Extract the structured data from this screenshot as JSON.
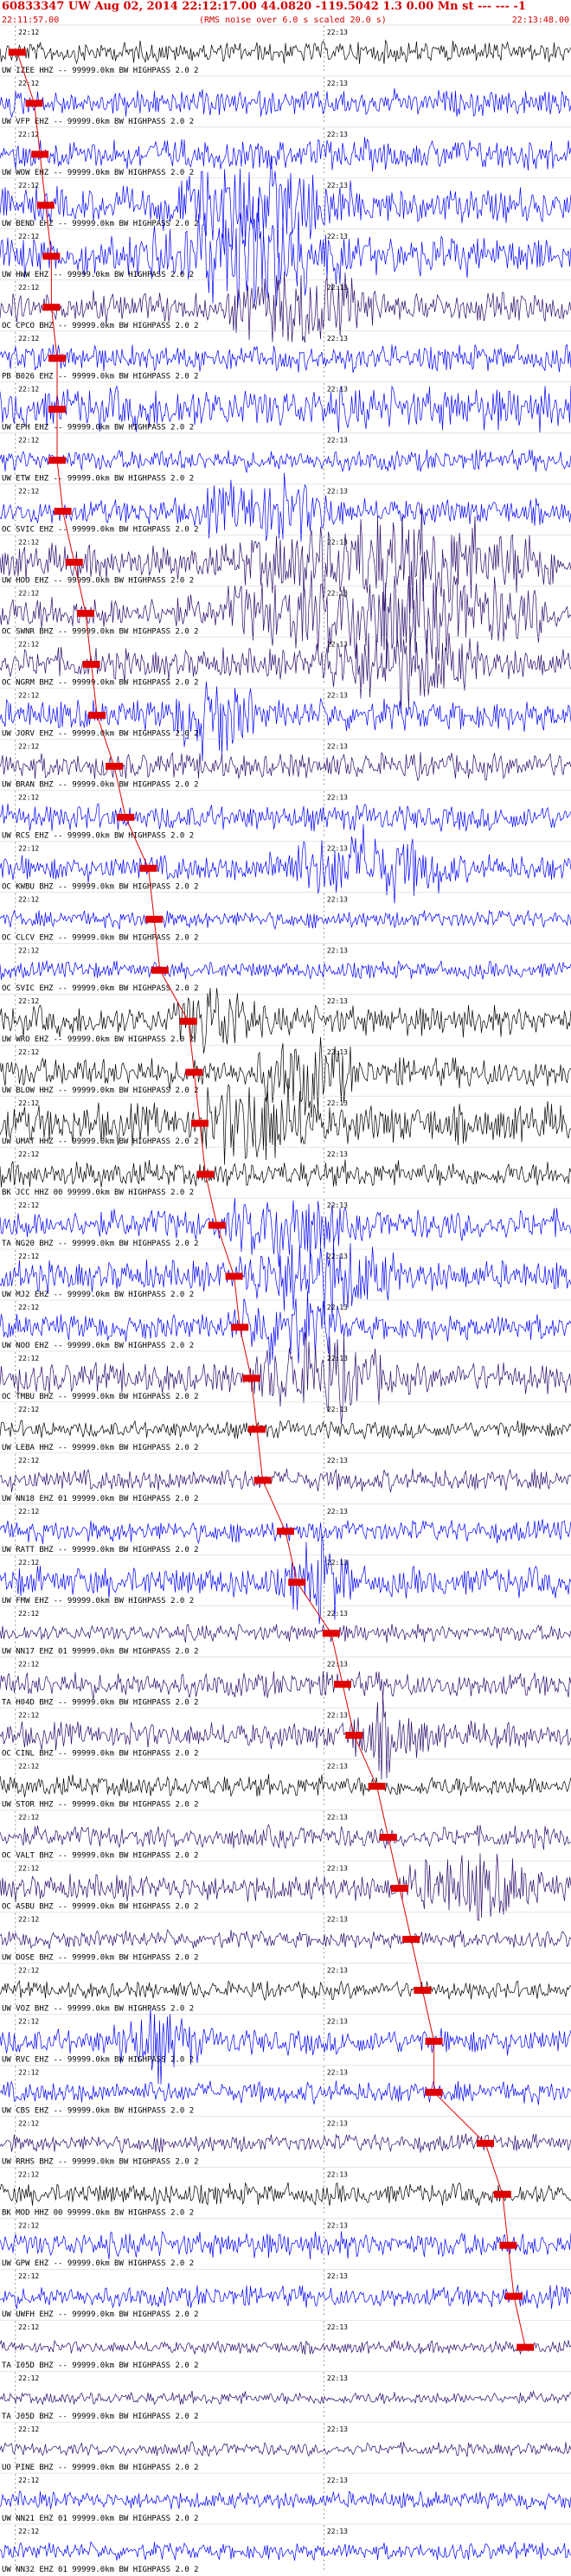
{
  "header": {
    "title": "60833347 UW Aug 02, 2014 22:12:17.00   44.0820  -119.5042  1.3 0.00 Mn st --- --- -1",
    "start_time": "22:11:57.00",
    "noise_note": "(RMS noise over 6.0 s scaled 20.0 s)",
    "end_time": "22:13:48.00"
  },
  "chart_data": {
    "type": "line",
    "time_range": [
      "22:11:57.00",
      "22:13:48.00"
    ],
    "minute_tick_labels": [
      "22:12",
      "22:13"
    ],
    "trace_colors": {
      "black": "#000000",
      "blue": "#0000ff",
      "purple": "#2a0a6a",
      "pick": "#e00000"
    },
    "traces": [
      {
        "label": "UW IZEE HHZ -- 99999.0km BW  HIGHPASS  2.0  2",
        "color": "black",
        "amp": 0.25,
        "burst": null,
        "pick": 0.03
      },
      {
        "label": "UW VFP EHZ -- 99999.0km BW  HIGHPASS  2.0  2",
        "color": "blue",
        "amp": 0.3,
        "burst": null,
        "pick": 0.06
      },
      {
        "label": "UW WOW EHZ -- 99999.0km BW  HIGHPASS  2.0  2",
        "color": "blue",
        "amp": 0.35,
        "burst": null,
        "pick": 0.07
      },
      {
        "label": "UW BEND EHZ -- 99999.0km BW  HIGHPASS  2.0  2",
        "color": "blue",
        "amp": 0.4,
        "burst": [
          0.28,
          0.62
        ],
        "pick": 0.08
      },
      {
        "label": "UW HWW EHZ -- 99999.0km BW  HIGHPASS  2.0  2",
        "color": "blue",
        "amp": 0.45,
        "burst": [
          0.25,
          0.6
        ],
        "pick": 0.09
      },
      {
        "label": "OC CPCO BHZ -- 99999.0km BW  HIGHPASS  2.0  2",
        "color": "purple",
        "amp": 0.35,
        "burst": [
          0.4,
          0.66
        ],
        "pick": 0.09
      },
      {
        "label": "PB B026 EHZ -- 99999.0km BW  HIGHPASS  2.0  2",
        "color": "blue",
        "amp": 0.3,
        "burst": null,
        "pick": 0.1
      },
      {
        "label": "UW EPH EHZ -- 99999.0km BW  HIGHPASS  2.0  2",
        "color": "blue",
        "amp": 0.5,
        "burst": null,
        "pick": 0.1
      },
      {
        "label": "UW ETW EHZ -- 99999.0km BW  HIGHPASS  2.0  2",
        "color": "blue",
        "amp": 0.25,
        "burst": null,
        "pick": 0.1
      },
      {
        "label": "OC SVIC EHZ -- 99999.0km BW  HIGHPASS  2.0  2",
        "color": "blue",
        "amp": 0.3,
        "burst": [
          0.35,
          0.6
        ],
        "pick": 0.11
      },
      {
        "label": "UW HOO EHZ -- 99999.0km BW  HIGHPASS  2.0  2",
        "color": "purple",
        "amp": 0.4,
        "burst": [
          0.42,
          0.98
        ],
        "pick": 0.13
      },
      {
        "label": "OC SWNR BHZ -- 99999.0km BW  HIGHPASS  2.0  2",
        "color": "purple",
        "amp": 0.4,
        "burst": [
          0.4,
          0.95
        ],
        "pick": 0.15
      },
      {
        "label": "OC NGRM BHZ -- 99999.0km BW  HIGHPASS  2.0  2",
        "color": "purple",
        "amp": 0.35,
        "burst": [
          0.55,
          0.85
        ],
        "pick": 0.16
      },
      {
        "label": "UW JORV EHZ -- 99999.0km BW  HIGHPASS  2.0  2",
        "color": "blue",
        "amp": 0.35,
        "burst": [
          0.3,
          0.45
        ],
        "pick": 0.17
      },
      {
        "label": "UW BRAN BHZ -- 99999.0km BW  HIGHPASS  2.0  2",
        "color": "purple",
        "amp": 0.3,
        "burst": null,
        "pick": 0.2
      },
      {
        "label": "UW RCS EHZ -- 99999.0km BW  HIGHPASS  2.0  2",
        "color": "blue",
        "amp": 0.3,
        "burst": null,
        "pick": 0.22
      },
      {
        "label": "OC KWBU BHZ -- 99999.0km BW  HIGHPASS  2.0  2",
        "color": "blue",
        "amp": 0.3,
        "burst": [
          0.47,
          0.8
        ],
        "pick": 0.26
      },
      {
        "label": "OC CLCV EHZ -- 99999.0km BW  HIGHPASS  2.0  2",
        "color": "blue",
        "amp": 0.2,
        "burst": null,
        "pick": 0.27
      },
      {
        "label": "OC SVIC EHZ -- 99999.0km BW  HIGHPASS  2.0  2",
        "color": "blue",
        "amp": 0.2,
        "burst": null,
        "pick": 0.28
      },
      {
        "label": "UW WRO EHZ -- 99999.0km BW  HIGHPASS  2.0  2",
        "color": "black",
        "amp": 0.35,
        "burst": [
          0.3,
          0.45
        ],
        "pick": 0.33
      },
      {
        "label": "UW BLOW HHZ -- 99999.0km BW  HIGHPASS  2.0  2",
        "color": "black",
        "amp": 0.35,
        "burst": [
          0.45,
          0.62
        ],
        "pick": 0.34
      },
      {
        "label": "UW UMAT HHZ -- 99999.0km BW  HIGHPASS  2.0  2",
        "color": "black",
        "amp": 0.45,
        "burst": [
          0.35,
          0.55
        ],
        "pick": 0.35
      },
      {
        "label": "BK JCC HHZ 00 99999.0km BW  HIGHPASS  2.0  2",
        "color": "black",
        "amp": 0.3,
        "burst": null,
        "pick": 0.36
      },
      {
        "label": "TA NG20 BHZ -- 99999.0km BW  HIGHPASS  2.0  2",
        "color": "blue",
        "amp": 0.35,
        "burst": [
          0.4,
          0.6
        ],
        "pick": 0.38
      },
      {
        "label": "UW MJ2 EHZ -- 99999.0km BW  HIGHPASS  2.0  2",
        "color": "blue",
        "amp": 0.35,
        "burst": [
          0.42,
          0.7
        ],
        "pick": 0.41
      },
      {
        "label": "UW NOO EHZ -- 99999.0km BW  HIGHPASS  2.0  2",
        "color": "blue",
        "amp": 0.3,
        "burst": [
          0.4,
          0.6
        ],
        "pick": 0.42
      },
      {
        "label": "OC TMBU BHZ -- 99999.0km BW  HIGHPASS  2.0  2",
        "color": "purple",
        "amp": 0.35,
        "burst": [
          0.44,
          0.68
        ],
        "pick": 0.44
      },
      {
        "label": "UW LEBA HHZ -- 99999.0km BW  HIGHPASS  2.0  2",
        "color": "black",
        "amp": 0.2,
        "burst": null,
        "pick": 0.45
      },
      {
        "label": "UW NN18 EHZ 01 99999.0km BW  HIGHPASS  2.0  2",
        "color": "purple",
        "amp": 0.25,
        "burst": null,
        "pick": 0.46
      },
      {
        "label": "UW RATT BHZ -- 99999.0km BW  HIGHPASS  2.0  2",
        "color": "blue",
        "amp": 0.25,
        "burst": null,
        "pick": 0.5
      },
      {
        "label": "UW FMW EHZ -- 99999.0km BW  HIGHPASS  2.0  2",
        "color": "blue",
        "amp": 0.35,
        "burst": [
          0.5,
          0.62
        ],
        "pick": 0.52
      },
      {
        "label": "UW NN17 EHZ 01 99999.0km BW  HIGHPASS  2.0  2",
        "color": "purple",
        "amp": 0.2,
        "burst": null,
        "pick": 0.58
      },
      {
        "label": "TA H04D BHZ -- 99999.0km BW  HIGHPASS  2.0  2",
        "color": "purple",
        "amp": 0.3,
        "burst": null,
        "pick": 0.6
      },
      {
        "label": "OC CINL BHZ -- 99999.0km BW  HIGHPASS  2.0  2",
        "color": "purple",
        "amp": 0.3,
        "burst": [
          0.6,
          0.75
        ],
        "pick": 0.62
      },
      {
        "label": "UW STOR HHZ -- 99999.0km BW  HIGHPASS  2.0  2",
        "color": "black",
        "amp": 0.25,
        "burst": null,
        "pick": 0.66
      },
      {
        "label": "OC VALT BHZ -- 99999.0km BW  HIGHPASS  2.0  2",
        "color": "purple",
        "amp": 0.25,
        "burst": null,
        "pick": 0.68
      },
      {
        "label": "OC ASBU BHZ -- 99999.0km BW  HIGHPASS  2.0  2",
        "color": "purple",
        "amp": 0.3,
        "burst": [
          0.7,
          0.95
        ],
        "pick": 0.7
      },
      {
        "label": "UW DOSE BHZ -- 99999.0km BW  HIGHPASS  2.0  2",
        "color": "purple",
        "amp": 0.2,
        "burst": null,
        "pick": 0.72
      },
      {
        "label": "UW VOZ BHZ -- 99999.0km BW  HIGHPASS  2.0  2",
        "color": "black",
        "amp": 0.2,
        "burst": null,
        "pick": 0.74
      },
      {
        "label": "UW RVC EHZ -- 99999.0km BW  HIGHPASS  2.0  2",
        "color": "blue",
        "amp": 0.3,
        "burst": [
          0.2,
          0.35
        ],
        "pick": 0.76
      },
      {
        "label": "UW CBS EHZ -- 99999.0km BW  HIGHPASS  2.0  2",
        "color": "blue",
        "amp": 0.25,
        "burst": null,
        "pick": 0.76
      },
      {
        "label": "UW RRHS BHZ -- 99999.0km BW  HIGHPASS  2.0  2",
        "color": "purple",
        "amp": 0.2,
        "burst": null,
        "pick": 0.85
      },
      {
        "label": "BK MOD HHZ 00 99999.0km BW  HIGHPASS  2.0  2",
        "color": "black",
        "amp": 0.25,
        "burst": null,
        "pick": 0.88
      },
      {
        "label": "UW GPW EHZ -- 99999.0km BW  HIGHPASS  2.0  2",
        "color": "blue",
        "amp": 0.3,
        "burst": null,
        "pick": 0.89
      },
      {
        "label": "UW UWFH EHZ -- 99999.0km BW  HIGHPASS  2.0  2",
        "color": "blue",
        "amp": 0.25,
        "burst": null,
        "pick": 0.9
      },
      {
        "label": "TA I05D BHZ -- 99999.0km BW  HIGHPASS  2.0  2",
        "color": "purple",
        "amp": 0.15,
        "burst": null,
        "pick": 0.92
      },
      {
        "label": "TA J05D BHZ -- 99999.0km BW  HIGHPASS  2.0  2",
        "color": "purple",
        "amp": 0.15,
        "burst": null,
        "pick": null
      },
      {
        "label": "UO PINE BHZ -- 99999.0km BW  HIGHPASS  2.0  2",
        "color": "purple",
        "amp": 0.15,
        "burst": null,
        "pick": null
      },
      {
        "label": "UW NN21 EHZ 01 99999.0km BW  HIGHPASS  2.0  2",
        "color": "blue",
        "amp": 0.2,
        "burst": null,
        "pick": null
      },
      {
        "label": "UW NN32 EHZ 01 99999.0km BW  HIGHPASS  2.0  2",
        "color": "blue",
        "amp": 0.2,
        "burst": null,
        "pick": null
      }
    ]
  }
}
